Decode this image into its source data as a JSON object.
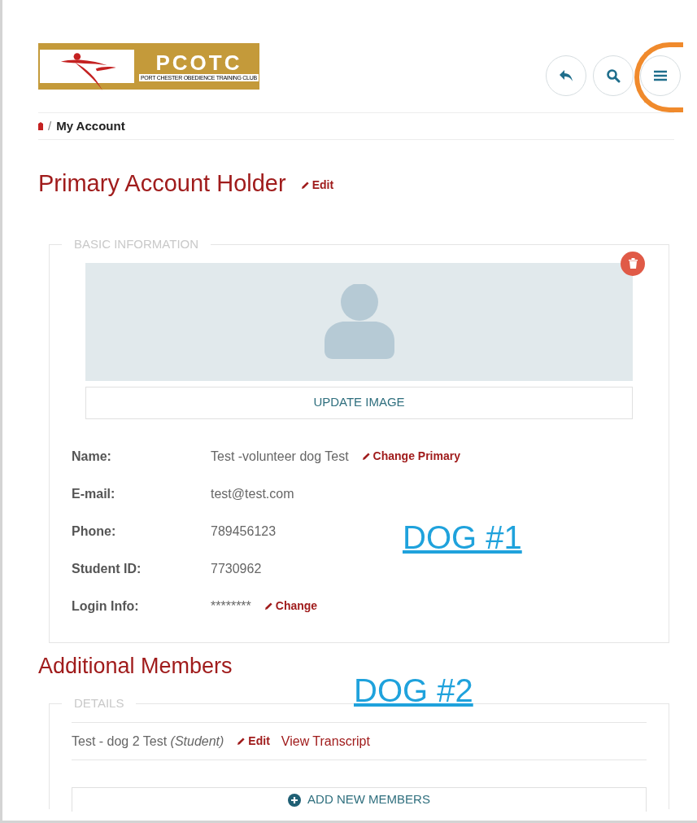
{
  "logo": {
    "title": "PCOTC",
    "subtitle": "PORT CHESTER OBEDIENCE TRAINING CLUB"
  },
  "header_buttons": [
    {
      "kind": "back"
    },
    {
      "kind": "search"
    },
    {
      "kind": "menu"
    }
  ],
  "breadcrumb": {
    "separator": "/",
    "current": "My Account"
  },
  "primary": {
    "title": "Primary Account Holder",
    "edit": "Edit",
    "legend": "BASIC INFORMATION",
    "update_image": "UPDATE IMAGE",
    "fields": [
      {
        "label": "Name:",
        "value": "Test -volunteer dog Test",
        "action": "Change Primary"
      },
      {
        "label": "E-mail:",
        "value": "test@test.com"
      },
      {
        "label": "Phone:",
        "value": "789456123"
      },
      {
        "label": "Student ID:",
        "value": "7730962"
      },
      {
        "label": "Login Info:",
        "value": "********",
        "action": "Change"
      }
    ]
  },
  "additional": {
    "title": "Additional Members",
    "legend": "DETAILS",
    "members": [
      {
        "name": "Test - dog 2 Test *(Student)*",
        "edit": "Edit",
        "transcript": "View Transcript"
      }
    ],
    "add_button": "ADD NEW MEMBERS"
  },
  "annotations": [
    {
      "text": "DOG #1"
    },
    {
      "text": "DOG #2"
    }
  ]
}
